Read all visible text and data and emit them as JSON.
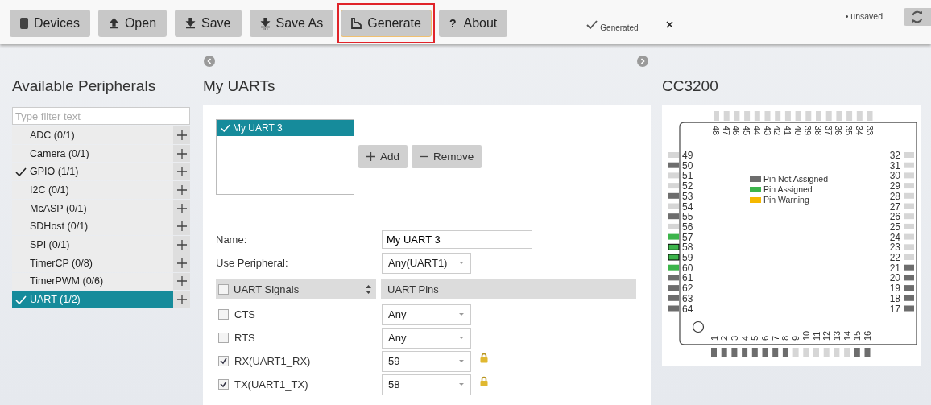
{
  "toolbar": {
    "buttons": [
      {
        "kind": "devices",
        "label": "Devices",
        "focused": false,
        "highlighted": false
      },
      {
        "kind": "open",
        "label": "Open",
        "focused": false,
        "highlighted": false
      },
      {
        "kind": "save",
        "label": "Save",
        "focused": false,
        "highlighted": false
      },
      {
        "kind": "saveas",
        "label": "Save As",
        "focused": false,
        "highlighted": false
      },
      {
        "kind": "generate",
        "label": "Generate",
        "focused": true,
        "highlighted": true
      },
      {
        "kind": "about",
        "icon": "?",
        "label": "About",
        "focused": false,
        "highlighted": false
      }
    ],
    "notification": {
      "text": "Generated"
    },
    "status": "• unsaved"
  },
  "peripherals": {
    "title": "Available Peripherals",
    "filter_placeholder": "Type filter text",
    "items": [
      {
        "label": "ADC (0/1)",
        "checked": false,
        "selected": false
      },
      {
        "label": "Camera (0/1)",
        "checked": false,
        "selected": false
      },
      {
        "label": "GPIO (1/1)",
        "checked": true,
        "selected": false
      },
      {
        "label": "I2C (0/1)",
        "checked": false,
        "selected": false
      },
      {
        "label": "McASP (0/1)",
        "checked": false,
        "selected": false
      },
      {
        "label": "SDHost (0/1)",
        "checked": false,
        "selected": false
      },
      {
        "label": "SPI (0/1)",
        "checked": false,
        "selected": false
      },
      {
        "label": "TimerCP (0/8)",
        "checked": false,
        "selected": false
      },
      {
        "label": "TimerPWM (0/6)",
        "checked": false,
        "selected": false
      },
      {
        "label": "UART (1/2)",
        "checked": true,
        "selected": true
      }
    ]
  },
  "uarts": {
    "title": "My UARTs",
    "instances": [
      {
        "label": "My UART 3",
        "checked": true,
        "selected": true
      }
    ],
    "add_label": "Add",
    "remove_label": "Remove",
    "name_label": "Name:",
    "name_value": "My UART 3",
    "peripheral_label": "Use Peripheral:",
    "peripheral_value": "Any(UART1)",
    "signals_header": "UART Signals",
    "signals_header_checked": false,
    "pins_header": "UART Pins",
    "signals": [
      {
        "label": "CTS",
        "checked": false,
        "pin": "Any",
        "locked": false
      },
      {
        "label": "RTS",
        "checked": false,
        "pin": "Any",
        "locked": false
      },
      {
        "label": "RX(UART1_RX)",
        "checked": true,
        "pin": "59",
        "locked": true
      },
      {
        "label": "TX(UART1_TX)",
        "checked": true,
        "pin": "58",
        "locked": true
      }
    ]
  },
  "device": {
    "title": "CC3200",
    "legend": [
      {
        "label": "Pin Not Assigned",
        "color": "#6d6d6d"
      },
      {
        "label": "Pin Assigned",
        "color": "#3cb44b"
      },
      {
        "label": "Pin Warning",
        "color": "#f5b800"
      }
    ],
    "pins": {
      "bottom": [
        {
          "label": "1",
          "kind": "unassigned",
          "selected": false
        },
        {
          "label": "2",
          "kind": "unassigned",
          "selected": false
        },
        {
          "label": "3",
          "kind": "unassigned",
          "selected": false
        },
        {
          "label": "4",
          "kind": "unassigned",
          "selected": false
        },
        {
          "label": "5",
          "kind": "unassigned",
          "selected": false
        },
        {
          "label": "6",
          "kind": "unassigned",
          "selected": false
        },
        {
          "label": "7",
          "kind": "unassigned",
          "selected": false
        },
        {
          "label": "8",
          "kind": "unassigned",
          "selected": false
        },
        {
          "label": "9",
          "kind": "free",
          "selected": false
        },
        {
          "label": "10",
          "kind": "free",
          "selected": false
        },
        {
          "label": "11",
          "kind": "free",
          "selected": false
        },
        {
          "label": "12",
          "kind": "free",
          "selected": false
        },
        {
          "label": "13",
          "kind": "free",
          "selected": false
        },
        {
          "label": "14",
          "kind": "free",
          "selected": false
        },
        {
          "label": "15",
          "kind": "unassigned",
          "selected": false
        },
        {
          "label": "16",
          "kind": "unassigned",
          "selected": false
        }
      ],
      "right": [
        {
          "label": "32",
          "kind": "free",
          "selected": false
        },
        {
          "label": "31",
          "kind": "free",
          "selected": false
        },
        {
          "label": "30",
          "kind": "free",
          "selected": false
        },
        {
          "label": "29",
          "kind": "free",
          "selected": false
        },
        {
          "label": "28",
          "kind": "free",
          "selected": false
        },
        {
          "label": "27",
          "kind": "free",
          "selected": false
        },
        {
          "label": "26",
          "kind": "free",
          "selected": false
        },
        {
          "label": "25",
          "kind": "free",
          "selected": false
        },
        {
          "label": "24",
          "kind": "free",
          "selected": false
        },
        {
          "label": "23",
          "kind": "free",
          "selected": false
        },
        {
          "label": "22",
          "kind": "free",
          "selected": false
        },
        {
          "label": "21",
          "kind": "unassigned",
          "selected": false
        },
        {
          "label": "20",
          "kind": "unassigned",
          "selected": false
        },
        {
          "label": "19",
          "kind": "unassigned",
          "selected": false
        },
        {
          "label": "18",
          "kind": "unassigned",
          "selected": false
        },
        {
          "label": "17",
          "kind": "unassigned",
          "selected": false
        }
      ],
      "top": [
        {
          "label": "48",
          "kind": "free",
          "selected": false
        },
        {
          "label": "47",
          "kind": "free",
          "selected": false
        },
        {
          "label": "46",
          "kind": "free",
          "selected": false
        },
        {
          "label": "45",
          "kind": "free",
          "selected": false
        },
        {
          "label": "44",
          "kind": "free",
          "selected": false
        },
        {
          "label": "43",
          "kind": "free",
          "selected": false
        },
        {
          "label": "42",
          "kind": "free",
          "selected": false
        },
        {
          "label": "41",
          "kind": "free",
          "selected": false
        },
        {
          "label": "40",
          "kind": "free",
          "selected": false
        },
        {
          "label": "39",
          "kind": "free",
          "selected": false
        },
        {
          "label": "38",
          "kind": "free",
          "selected": false
        },
        {
          "label": "37",
          "kind": "free",
          "selected": false
        },
        {
          "label": "36",
          "kind": "free",
          "selected": false
        },
        {
          "label": "35",
          "kind": "free",
          "selected": false
        },
        {
          "label": "34",
          "kind": "free",
          "selected": false
        },
        {
          "label": "33",
          "kind": "free",
          "selected": false
        }
      ],
      "left": [
        {
          "label": "49",
          "kind": "free",
          "selected": false
        },
        {
          "label": "50",
          "kind": "unassigned",
          "selected": false
        },
        {
          "label": "51",
          "kind": "free",
          "selected": false
        },
        {
          "label": "52",
          "kind": "free",
          "selected": false
        },
        {
          "label": "53",
          "kind": "unassigned",
          "selected": false
        },
        {
          "label": "54",
          "kind": "free",
          "selected": false
        },
        {
          "label": "55",
          "kind": "unassigned",
          "selected": false
        },
        {
          "label": "56",
          "kind": "free",
          "selected": false
        },
        {
          "label": "57",
          "kind": "assigned",
          "selected": false
        },
        {
          "label": "58",
          "kind": "assigned",
          "selected": true
        },
        {
          "label": "59",
          "kind": "assigned",
          "selected": true
        },
        {
          "label": "60",
          "kind": "assigned",
          "selected": false
        },
        {
          "label": "61",
          "kind": "unassigned",
          "selected": false
        },
        {
          "label": "62",
          "kind": "unassigned",
          "selected": false
        },
        {
          "label": "63",
          "kind": "unassigned",
          "selected": false
        },
        {
          "label": "64",
          "kind": "unassigned",
          "selected": false
        }
      ]
    }
  }
}
